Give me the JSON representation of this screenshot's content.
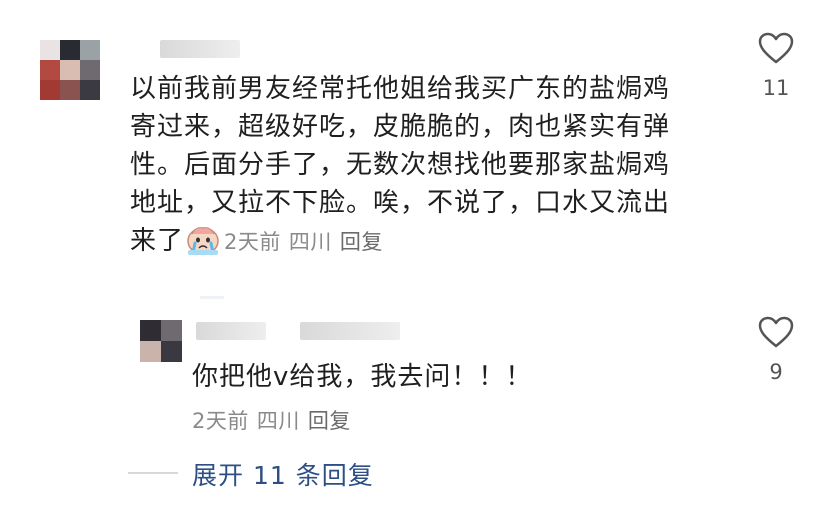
{
  "comment": {
    "text_line_1": "以前我前男友经常托他姐给我买广东的盐焗鸡",
    "text_line_2": "寄过来，超级好吃，皮脆脆的，肉也紧实有弹",
    "text_line_3": "性。后面分手了，无数次想找他要那家盐焗鸡",
    "text_line_4": "地址，又拉不下脸。唉，不说了，口水又流出",
    "text_line_5": "来了",
    "emoji": "crying-emoji",
    "time": "2天前",
    "location": "四川",
    "reply_label": "回复",
    "like_count": "11",
    "like_icon": "heart-outline-icon"
  },
  "reply": {
    "text": "你把他v给我，我去问！！！",
    "time": "2天前",
    "location": "四川",
    "reply_label": "回复",
    "like_count": "9",
    "like_icon": "heart-outline-icon"
  },
  "expand": {
    "label": "展开 11 条回复"
  },
  "colors": {
    "link": "#2d4f84",
    "meta": "#8a8a8a"
  }
}
